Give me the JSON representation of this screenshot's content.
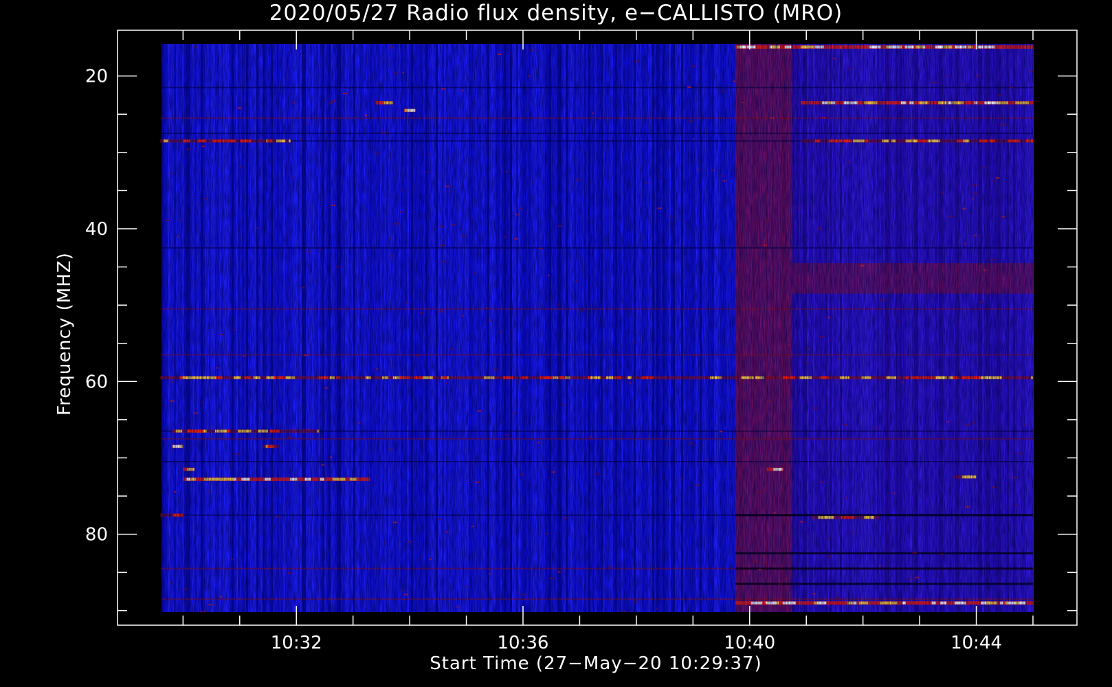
{
  "chart_data": {
    "type": "heatmap",
    "title": "2020/05/27  Radio flux density, e−CALLISTO (MRO)",
    "xlabel": "Start Time (27−May−20 10:29:37)",
    "ylabel": "Frequency (MHZ)",
    "x_ticks": [
      "10:32",
      "10:36",
      "10:40",
      "10:44"
    ],
    "x_tick_minutes": [
      32,
      36,
      40,
      44
    ],
    "y_ticks": [
      "20",
      "40",
      "60",
      "80"
    ],
    "y_tick_values": [
      20,
      40,
      60,
      80
    ],
    "x_range_minutes": [
      29.62,
      45.0
    ],
    "y_range_mhz": [
      15.8,
      90.2
    ],
    "y_inverted": true,
    "colormap": [
      "#0000b0",
      "#2020ff",
      "#9a1010",
      "#ff2000",
      "#ffd040",
      "#ffffff"
    ],
    "background_level": "blue",
    "burst_segment": {
      "start_minute": 39.75,
      "end_minute": 40.75
    },
    "enhanced_after_minute": 39.75,
    "bright_features": [
      {
        "x_start": 33.4,
        "x_end": 33.7,
        "freq": 23.5,
        "intensity": "high"
      },
      {
        "x_start": 33.9,
        "x_end": 34.1,
        "freq": 24.5,
        "intensity": "high"
      },
      {
        "x_start": 40.9,
        "x_end": 45.0,
        "freq": 23.5,
        "intensity": "high"
      },
      {
        "x_start": 29.6,
        "x_end": 31.9,
        "freq": 28.5,
        "intensity": "medium"
      },
      {
        "x_start": 40.9,
        "x_end": 45.0,
        "freq": 28.5,
        "intensity": "medium"
      },
      {
        "x_start": 29.6,
        "x_end": 45.0,
        "freq": 59.5,
        "intensity": "medium"
      },
      {
        "x_start": 29.8,
        "x_end": 32.4,
        "freq": 66.5,
        "intensity": "medium"
      },
      {
        "x_start": 29.8,
        "x_end": 30.0,
        "freq": 68.5,
        "intensity": "high"
      },
      {
        "x_start": 31.4,
        "x_end": 31.7,
        "freq": 68.5,
        "intensity": "medium"
      },
      {
        "x_start": 30.0,
        "x_end": 30.2,
        "freq": 71.5,
        "intensity": "high"
      },
      {
        "x_start": 30.0,
        "x_end": 33.3,
        "freq": 72.8,
        "intensity": "high"
      },
      {
        "x_start": 40.3,
        "x_end": 40.6,
        "freq": 71.5,
        "intensity": "high"
      },
      {
        "x_start": 43.6,
        "x_end": 44.0,
        "freq": 72.5,
        "intensity": "medium"
      },
      {
        "x_start": 29.6,
        "x_end": 30.0,
        "freq": 77.5,
        "intensity": "medium"
      },
      {
        "x_start": 41.1,
        "x_end": 42.3,
        "freq": 77.8,
        "intensity": "medium"
      },
      {
        "x_start": 39.75,
        "x_end": 45.0,
        "freq": 89.0,
        "intensity": "high"
      },
      {
        "x_start": 39.75,
        "x_end": 45.0,
        "freq": 16.2,
        "intensity": "high"
      }
    ]
  }
}
